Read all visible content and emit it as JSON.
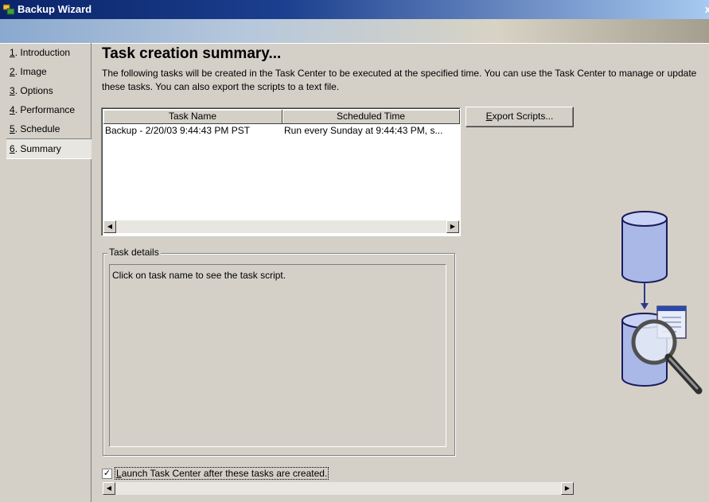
{
  "window": {
    "title": "Backup Wizard",
    "close_glyph": "x"
  },
  "nav": {
    "items": [
      {
        "num": "1",
        "label": ". Introduction"
      },
      {
        "num": "2",
        "label": ". Image"
      },
      {
        "num": "3",
        "label": ". Options"
      },
      {
        "num": "4",
        "label": ". Performance"
      },
      {
        "num": "5",
        "label": ". Schedule"
      },
      {
        "num": "6",
        "label": ". Summary"
      }
    ],
    "active_index": 5
  },
  "main": {
    "heading": "Task creation summary...",
    "description": "The following tasks will be created in the Task Center to be executed at the specified time. You can use the Task Center to manage or update these tasks. You can also export the scripts to a text file."
  },
  "tasks_table": {
    "columns": [
      "Task Name",
      "Scheduled Time"
    ],
    "rows": [
      [
        "Backup - 2/20/03 9:44:43 PM PST",
        "Run every Sunday at 9:44:43 PM, s..."
      ]
    ]
  },
  "export_button": {
    "mnemonic": "E",
    "rest": "xport Scripts..."
  },
  "task_details": {
    "label": "Task details",
    "text": "Click on task name to see the task script."
  },
  "launch_checkbox": {
    "checked": true,
    "mnemonic": "L",
    "rest": "aunch Task Center after these tasks are created."
  },
  "icons": [
    "backup-wizard-icon",
    "scroll-left-icon",
    "scroll-right-icon",
    "database-icon",
    "arrow-down-icon",
    "database-inspect-icon",
    "magnifier-icon",
    "document-icon"
  ],
  "colors": {
    "titlebar": "#0a246a",
    "face": "#d4d0c8",
    "db_blue": "#aab8e8"
  }
}
